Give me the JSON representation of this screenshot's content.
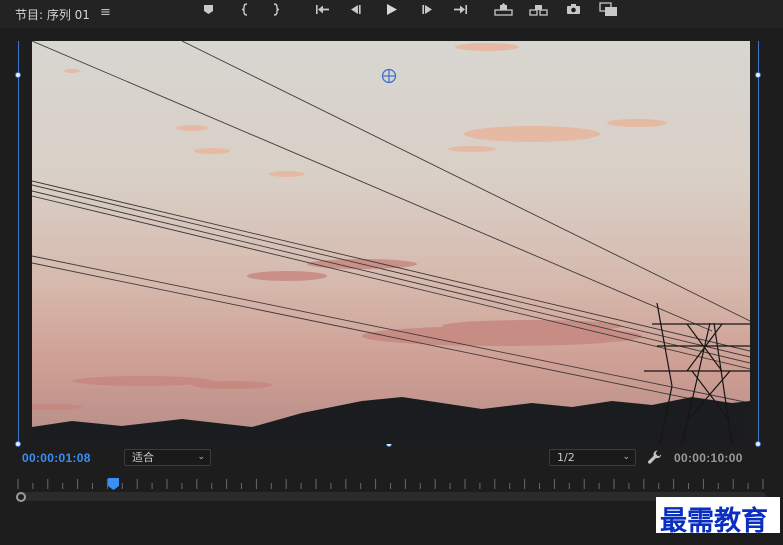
{
  "panel": {
    "title": "节目: 序列 01",
    "menu_glyph": "≡"
  },
  "monitor": {
    "current_timecode": "00:00:01:08",
    "duration_timecode": "00:00:10:00",
    "zoom_value": "适合",
    "resolution_value": "1/2",
    "playhead_fraction": 0.13
  },
  "controls": {
    "items": [
      {
        "name": "add-marker-button",
        "icon": "marker-icon"
      },
      {
        "name": "mark-in-button",
        "icon": "mark-in-icon"
      },
      {
        "name": "mark-out-button",
        "icon": "mark-out-icon"
      },
      {
        "name": "go-to-in-button",
        "icon": "go-to-in-icon"
      },
      {
        "name": "step-back-button",
        "icon": "step-back-icon"
      },
      {
        "name": "play-button",
        "icon": "play-icon"
      },
      {
        "name": "step-forward-button",
        "icon": "step-forward-icon"
      },
      {
        "name": "go-to-out-button",
        "icon": "go-to-out-icon"
      },
      {
        "name": "lift-button",
        "icon": "lift-icon"
      },
      {
        "name": "extract-button",
        "icon": "extract-icon"
      },
      {
        "name": "export-frame-button",
        "icon": "camera-icon"
      },
      {
        "name": "compare-view-button",
        "icon": "compare-icon"
      }
    ]
  },
  "watermark": {
    "text": "最需教育"
  },
  "colors": {
    "timecode_accent": "#3b8ef3",
    "guide_blue": "#3d77c9",
    "panel_bg": "#1d1d1d",
    "watermark_text": "#0a2dc2"
  }
}
